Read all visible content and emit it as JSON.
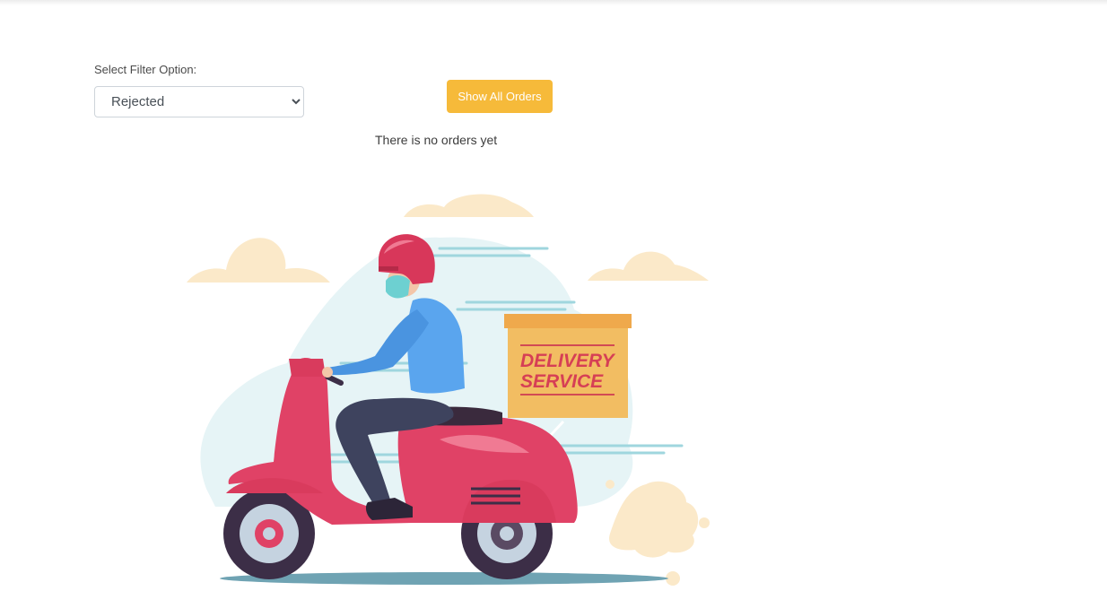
{
  "filter": {
    "label": "Select Filter Option:",
    "selected": "Rejected",
    "options": [
      "Rejected"
    ]
  },
  "actions": {
    "show_all_label": "Show All Orders"
  },
  "empty_state": {
    "message": "There is no orders yet",
    "illustration_text_line1": "DELIVERY",
    "illustration_text_line2": "SERVICE"
  },
  "colors": {
    "accent": "#f6ba3a",
    "scooter": "#e04266",
    "helmet": "#d8375a",
    "box": "#f2bd62",
    "shirt": "#5aa5ee",
    "cloud": "#fbe9c9",
    "sky": "#e6f4f6"
  }
}
